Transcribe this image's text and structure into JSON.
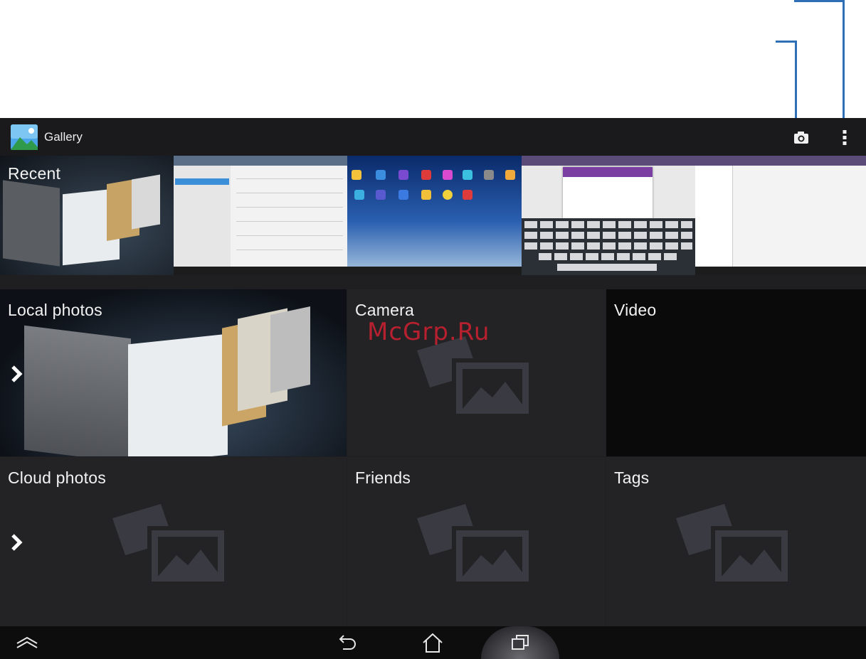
{
  "app": {
    "title": "Gallery",
    "accent": "#2e6fb5",
    "background": "#1f1f21"
  },
  "actionbar": {
    "camera_icon": "camera-icon",
    "overflow_icon": "overflow-menu-icon"
  },
  "albums": {
    "recent": {
      "label": "Recent"
    },
    "local_photos": {
      "label": "Local photos"
    },
    "camera": {
      "label": "Camera"
    },
    "video": {
      "label": "Video"
    },
    "cloud_photos": {
      "label": "Cloud photos"
    },
    "friends": {
      "label": "Friends"
    },
    "tags": {
      "label": "Tags"
    }
  },
  "watermark": "McGrp.Ru",
  "navbar": {
    "hide_icon": "hide-bar-icon",
    "back_icon": "back-icon",
    "home_icon": "home-icon",
    "recent_apps_icon": "recent-apps-icon"
  }
}
